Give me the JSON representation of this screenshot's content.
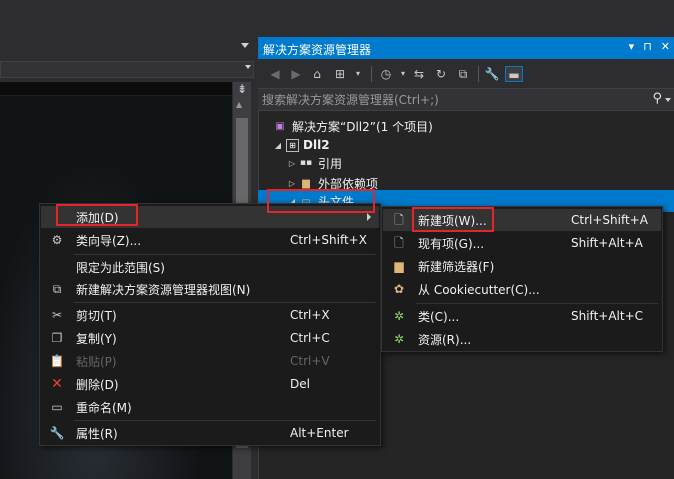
{
  "solution_explorer": {
    "title": "解决方案资源管理器",
    "title_buttons": [
      "▾",
      "⊓",
      "✕"
    ],
    "search": {
      "placeholder": "搜索解决方案资源管理器(Ctrl+;)"
    },
    "tree": [
      {
        "label": "解决方案“Dll2”(1 个项目)",
        "icon": "solution-icon"
      },
      {
        "label": "Dll2",
        "icon": "cpp-project-icon",
        "expanded": true
      },
      {
        "label": "引用",
        "icon": "references-icon",
        "collapsed": true
      },
      {
        "label": "外部依赖项",
        "icon": "external-deps-folder-icon",
        "collapsed": true
      },
      {
        "label": "头文件",
        "icon": "filter-folder-icon",
        "expanded": true,
        "selected": true
      }
    ]
  },
  "editor": {
    "split_button": "⇟"
  },
  "context_menu": {
    "items": [
      {
        "label": "添加(D)",
        "shortcut": "",
        "icon": "",
        "submenu": true,
        "highlighted": true
      },
      {
        "label": "类向导(Z)...",
        "shortcut": "Ctrl+Shift+X",
        "icon": "class-wizard-icon"
      },
      {
        "label": "限定为此范围(S)",
        "shortcut": "",
        "icon": ""
      },
      {
        "label": "新建解决方案资源管理器视图(N)",
        "shortcut": "",
        "icon": "new-view-icon"
      },
      {
        "label": "剪切(T)",
        "shortcut": "Ctrl+X",
        "icon": "cut-icon"
      },
      {
        "label": "复制(Y)",
        "shortcut": "Ctrl+C",
        "icon": "copy-icon"
      },
      {
        "label": "粘贴(P)",
        "shortcut": "Ctrl+V",
        "icon": "paste-icon",
        "disabled": true
      },
      {
        "label": "删除(D)",
        "shortcut": "Del",
        "icon": "delete-icon"
      },
      {
        "label": "重命名(M)",
        "shortcut": "",
        "icon": "rename-icon"
      },
      {
        "label": "属性(R)",
        "shortcut": "Alt+Enter",
        "icon": "properties-icon"
      }
    ]
  },
  "submenu": {
    "items": [
      {
        "label": "新建项(W)...",
        "shortcut": "Ctrl+Shift+A",
        "icon": "new-item-icon",
        "highlighted": true
      },
      {
        "label": "现有项(G)...",
        "shortcut": "Shift+Alt+A",
        "icon": "existing-item-icon"
      },
      {
        "label": "新建筛选器(F)",
        "shortcut": "",
        "icon": "new-filter-icon"
      },
      {
        "label": "从 Cookiecutter(C)...",
        "shortcut": "",
        "icon": "cookiecutter-icon"
      },
      {
        "label": "类(C)...",
        "shortcut": "Shift+Alt+C",
        "icon": "class-icon"
      },
      {
        "label": "资源(R)...",
        "shortcut": "",
        "icon": "resource-icon"
      }
    ]
  },
  "colors": {
    "accent": "#007acc",
    "highlight_box": "#e3262b",
    "menu_bg": "#1b1b1c"
  }
}
